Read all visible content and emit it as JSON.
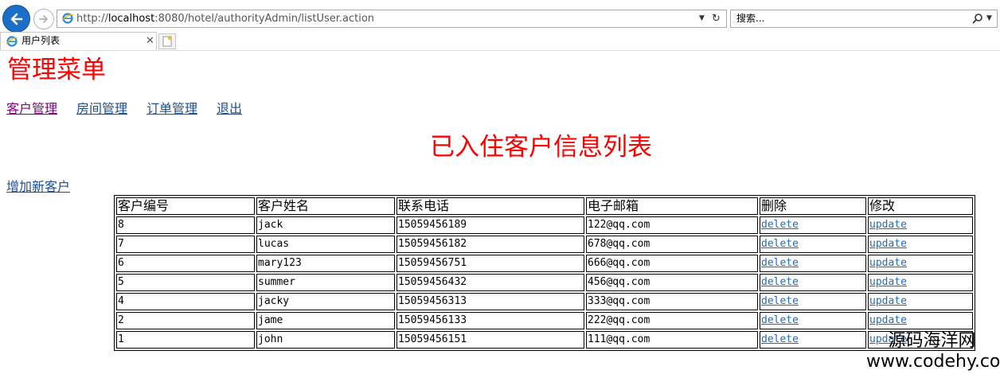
{
  "browser": {
    "address_prefix": "http://",
    "address_host": "localhost",
    "address_path": ":8080/hotel/authorityAdmin/listUser.action",
    "search_placeholder": "搜索...",
    "tab_title": "用户列表"
  },
  "page": {
    "menu_title": "管理菜单",
    "nav": [
      "客户管理",
      "房间管理",
      "订单管理",
      "退出"
    ],
    "list_title": "已入住客户信息列表",
    "add_link": "增加新客户"
  },
  "table": {
    "headers": [
      "客户编号",
      "客户姓名",
      "联系电话",
      "电子邮箱",
      "删除",
      "修改"
    ],
    "delete_label": "delete",
    "update_label": "update",
    "rows": [
      {
        "id": "8",
        "name": "jack",
        "phone": "15059456189",
        "email": "122@qq.com"
      },
      {
        "id": "7",
        "name": "lucas",
        "phone": "15059456182",
        "email": "678@qq.com"
      },
      {
        "id": "6",
        "name": "mary123",
        "phone": "15059456751",
        "email": "666@qq.com"
      },
      {
        "id": "5",
        "name": "summer",
        "phone": "15059456432",
        "email": "456@qq.com"
      },
      {
        "id": "4",
        "name": "jacky",
        "phone": "15059456313",
        "email": "333@qq.com"
      },
      {
        "id": "2",
        "name": "jame",
        "phone": "15059456133",
        "email": "222@qq.com"
      },
      {
        "id": "1",
        "name": "john",
        "phone": "15059456151",
        "email": "111@qq.com"
      }
    ]
  },
  "watermark": {
    "cn": "源码海洋网",
    "url": "www.codehy.com"
  },
  "colors": {
    "title_red": "#ff0000",
    "link_blue": "#1a4d9a",
    "visited_purple": "#800080",
    "ie_back_blue": "#1c6fc9"
  }
}
